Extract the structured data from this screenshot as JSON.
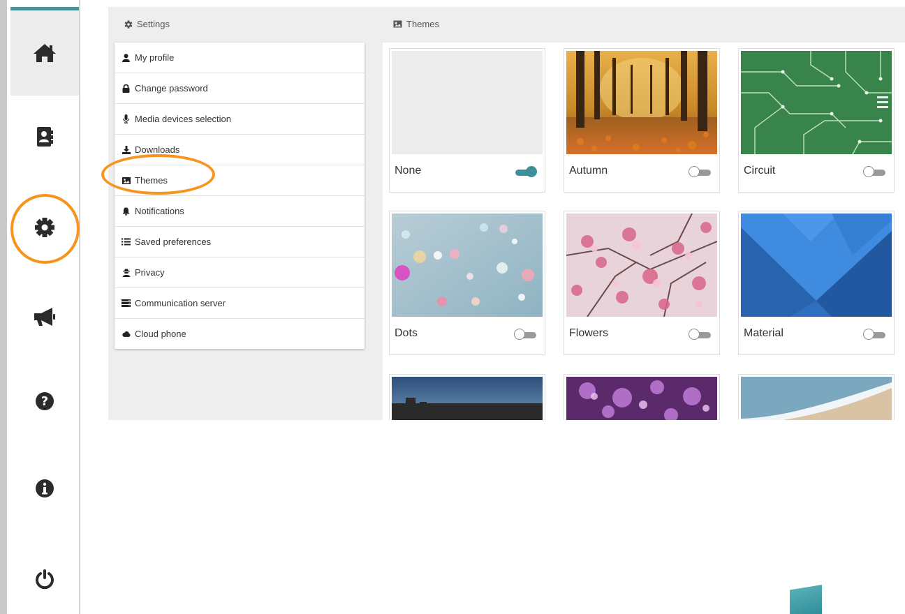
{
  "colors": {
    "accent": "#3d8f9a",
    "highlight": "#f7941d",
    "panel_bg": "#eeeeee",
    "icon": "#2b2b2b"
  },
  "sidebar": {
    "items": [
      {
        "name": "home",
        "icon": "home-icon"
      },
      {
        "name": "contacts",
        "icon": "address-book-icon"
      },
      {
        "name": "settings",
        "icon": "gear-icon"
      },
      {
        "name": "announcements",
        "icon": "megaphone-icon"
      },
      {
        "name": "help",
        "icon": "question-circle-icon"
      },
      {
        "name": "info",
        "icon": "info-circle-icon"
      },
      {
        "name": "logout",
        "icon": "power-icon"
      }
    ]
  },
  "breadcrumbs": {
    "settings": "Settings",
    "themes": "Themes"
  },
  "menu": {
    "items": [
      {
        "label": "My profile",
        "icon": "user-icon"
      },
      {
        "label": "Change password",
        "icon": "lock-icon"
      },
      {
        "label": "Media devices selection",
        "icon": "microphone-icon"
      },
      {
        "label": "Downloads",
        "icon": "download-icon"
      },
      {
        "label": "Themes",
        "icon": "image-icon"
      },
      {
        "label": "Notifications",
        "icon": "bell-icon"
      },
      {
        "label": "Saved preferences",
        "icon": "list-icon"
      },
      {
        "label": "Privacy",
        "icon": "user-secret-icon"
      },
      {
        "label": "Communication server",
        "icon": "server-icon"
      },
      {
        "label": "Cloud phone",
        "icon": "cloud-icon"
      }
    ]
  },
  "themes": {
    "cards": [
      {
        "name": "None",
        "enabled": true
      },
      {
        "name": "Autumn",
        "enabled": false
      },
      {
        "name": "Circuit",
        "enabled": false
      },
      {
        "name": "Dots",
        "enabled": false
      },
      {
        "name": "Flowers",
        "enabled": false
      },
      {
        "name": "Material",
        "enabled": false
      },
      {
        "name": "",
        "enabled": false
      },
      {
        "name": "",
        "enabled": false
      },
      {
        "name": "",
        "enabled": false
      }
    ]
  }
}
